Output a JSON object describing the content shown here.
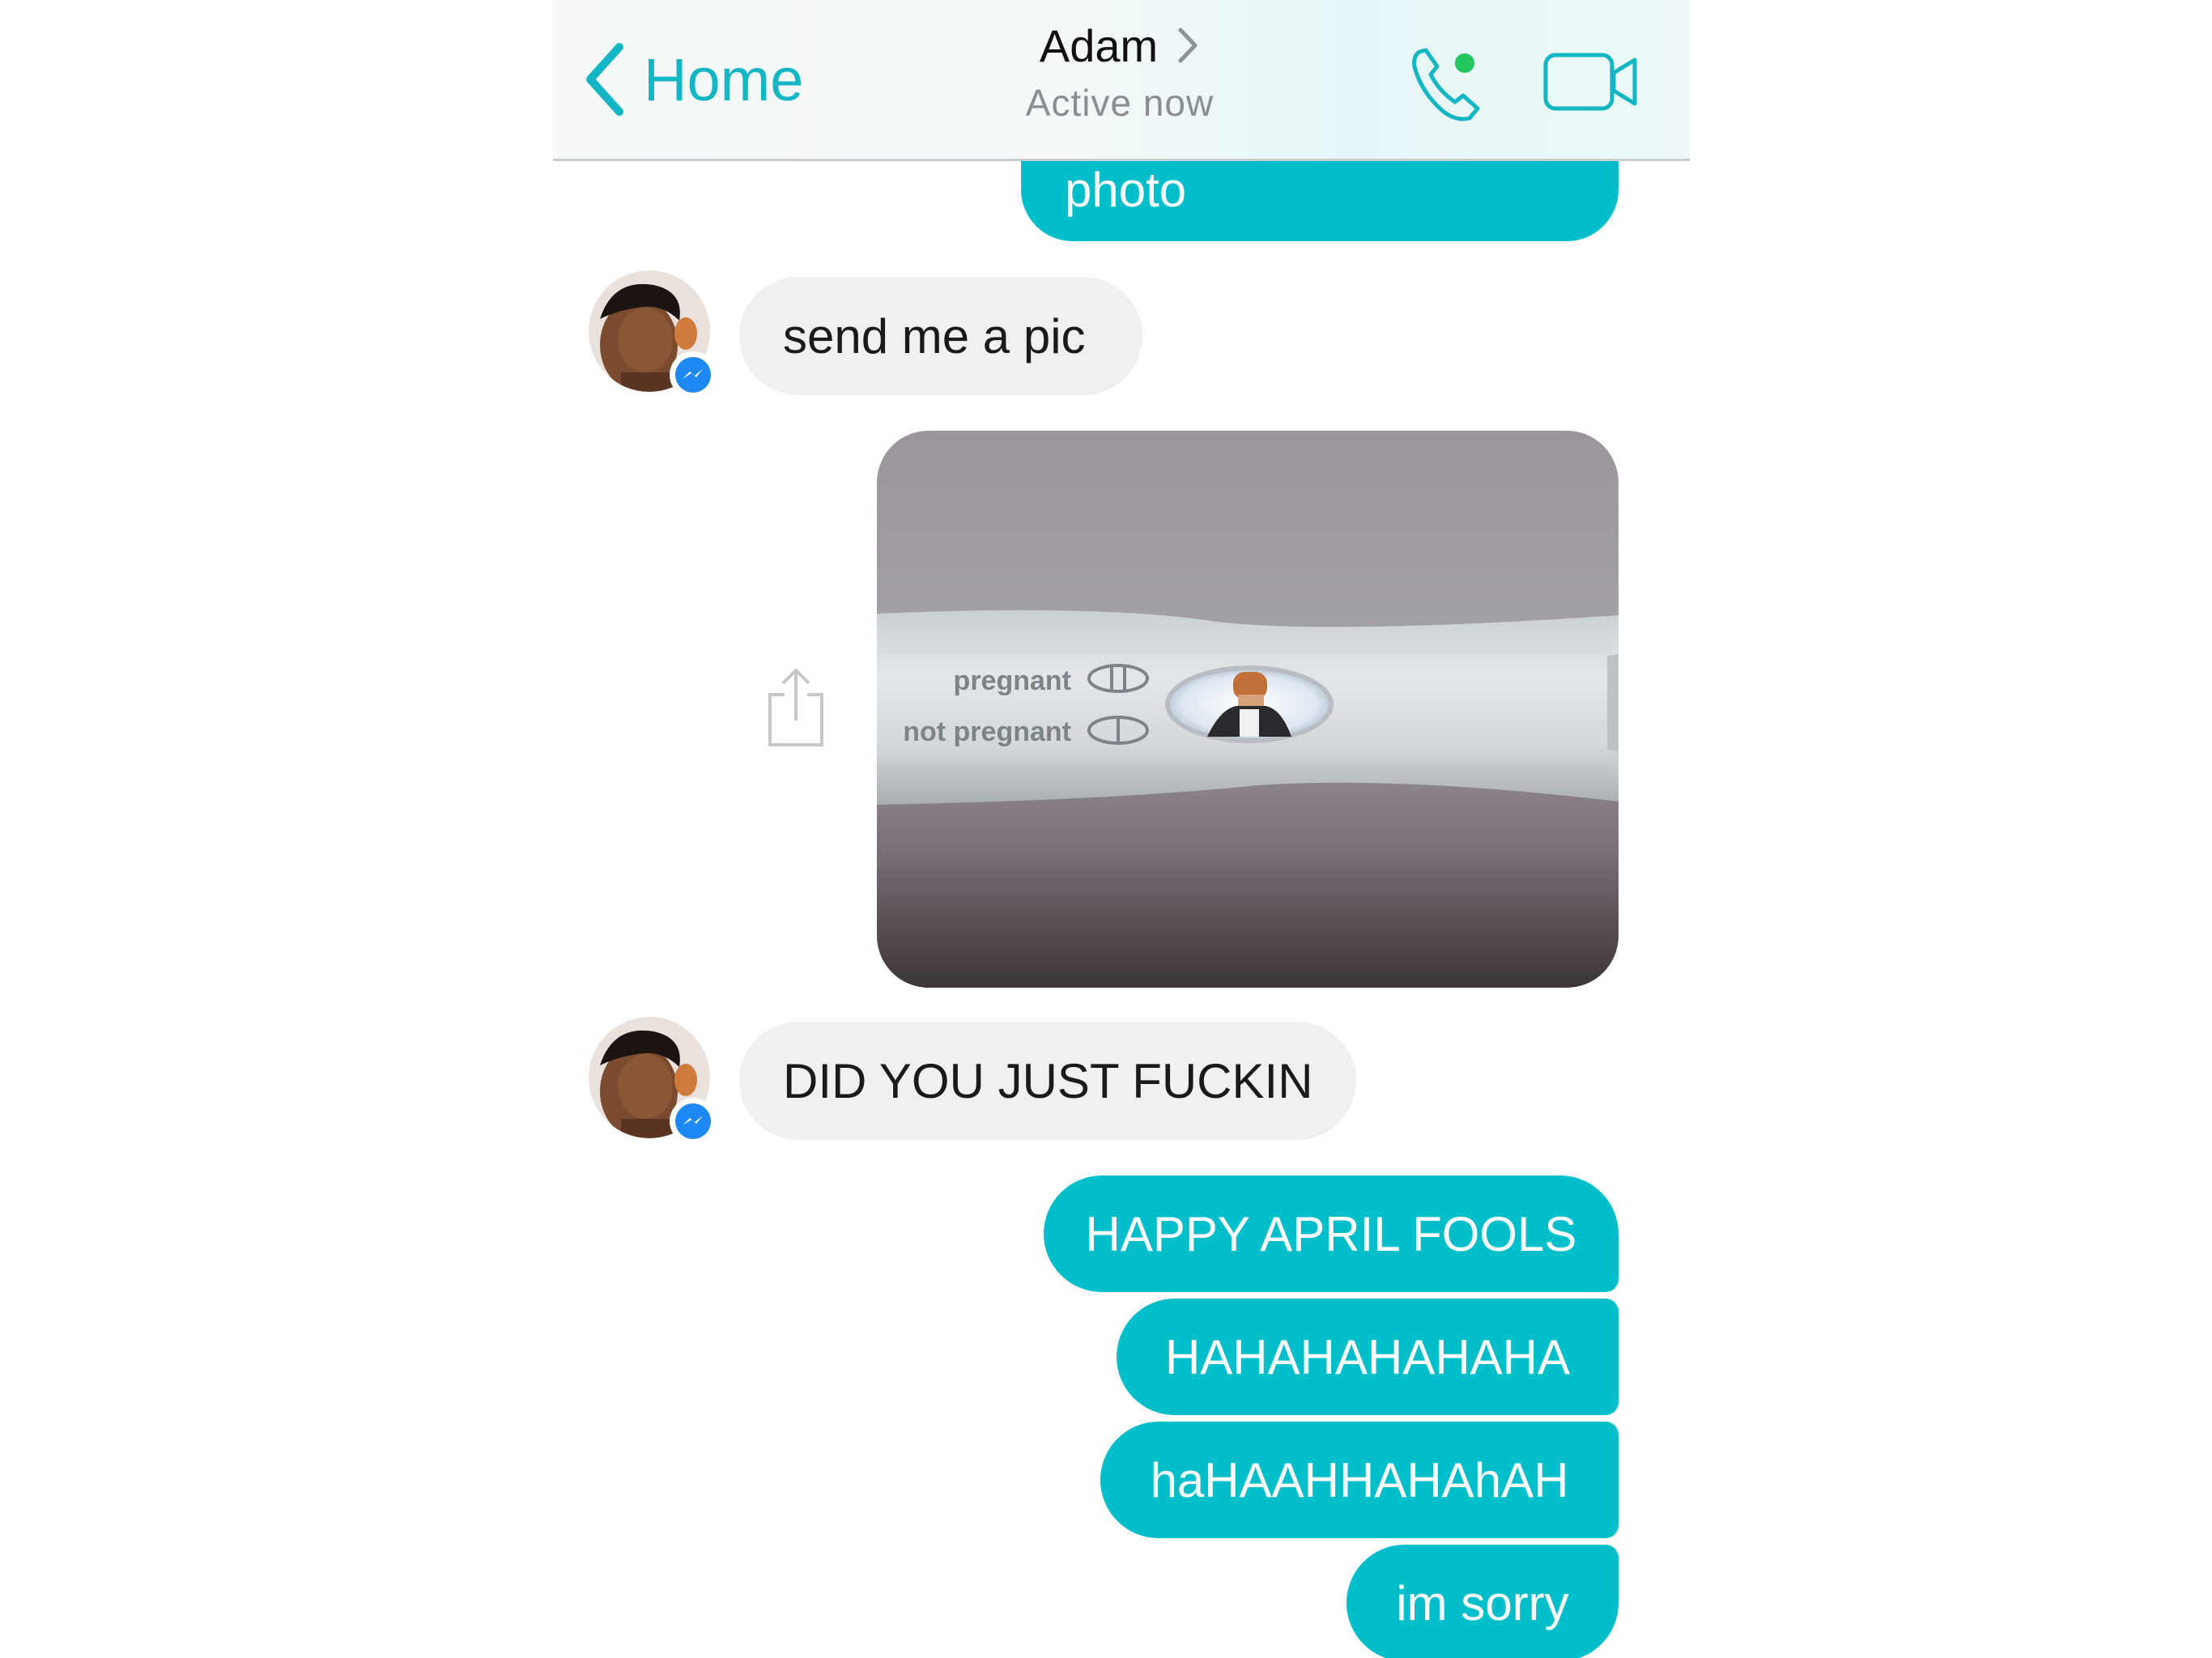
{
  "header": {
    "back_label": "Home",
    "contact_name": "Adam",
    "status": "Active now",
    "presence_color": "#22c55e",
    "accent_color": "#14b6c4"
  },
  "messages": [
    {
      "from": "me",
      "text": "photo"
    },
    {
      "from": "Adam",
      "text": "send me a pic"
    },
    {
      "from": "me",
      "type": "image",
      "image": {
        "label_pregnant": "pregnant",
        "label_not_pregnant": "not pregnant"
      }
    },
    {
      "from": "Adam",
      "text": "DID YOU JUST FUCKIN"
    },
    {
      "from": "me",
      "text": "HAPPY APRIL FOOLS"
    },
    {
      "from": "me",
      "text": "HAHAHAHAHAHA"
    },
    {
      "from": "me",
      "text": "haHAAHHAHAhAH"
    },
    {
      "from": "me",
      "text": "im sorry"
    }
  ],
  "colors": {
    "outgoing_bubble": "#00bfca",
    "incoming_bubble": "#f0eff1",
    "messenger_badge": "#1e88f5"
  },
  "icons": {
    "back": "chevron-left-icon",
    "title_chevron": "chevron-right-icon",
    "call": "phone-icon",
    "video": "video-camera-icon",
    "share": "share-icon",
    "badge": "messenger-icon"
  }
}
